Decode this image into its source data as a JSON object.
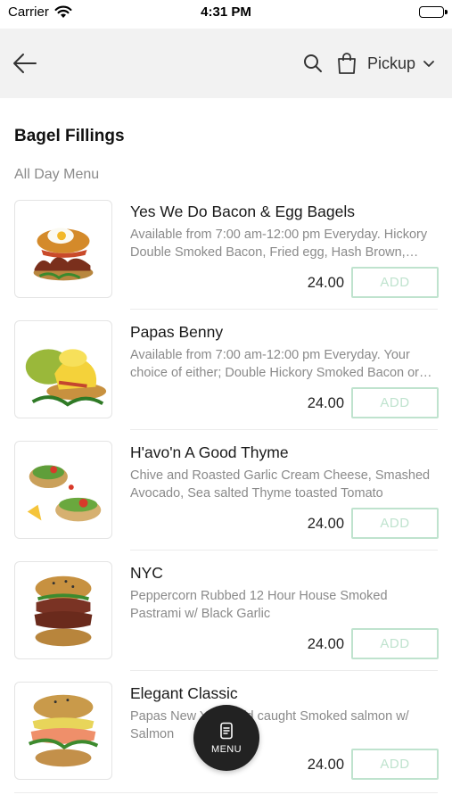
{
  "status_bar": {
    "carrier": "Carrier",
    "time": "4:31 PM"
  },
  "header": {
    "back_icon": "arrow-left-icon",
    "search_icon": "search-icon",
    "bag_icon": "shopping-bag-icon",
    "pickup_label": "Pickup",
    "dropdown_icon": "chevron-down-icon",
    "background": "#f2f2f2"
  },
  "category": {
    "title": "Bagel Fillings",
    "subtitle": "All Day Menu"
  },
  "items": [
    {
      "name": "Yes We Do Bacon & Egg Bagels",
      "description": "Available from 7:00 am-12:00 pm  Everyday. Hickory Double Smoked Bacon, Fried egg, Hash Brown, Tomato Relish",
      "price": "24.00",
      "add_label": "ADD"
    },
    {
      "name": "Papas Benny",
      "description": "Available from  7:00 am-12:00 pm Everyday. Your choice of either; Double Hickory Smoked Bacon or Smoked Salmon",
      "price": "24.00",
      "add_label": "ADD"
    },
    {
      "name": "H'avo'n A Good Thyme",
      "description": "Chive and Roasted Garlic Cream Cheese, Smashed Avocado, Sea salted Thyme toasted Tomato",
      "price": "24.00",
      "add_label": "ADD"
    },
    {
      "name": "NYC",
      "description": "Peppercorn Rubbed 12 Hour House Smoked Pastrami w/ Black Garlic",
      "price": "24.00",
      "add_label": "ADD"
    },
    {
      "name": "Elegant Classic",
      "description": "Papas New York Wild caught Smoked salmon w/ Salmon",
      "price": "24.00",
      "add_label": "ADD"
    }
  ],
  "fab": {
    "label": "MENU",
    "icon": "menu-book-icon"
  },
  "colors": {
    "accent": "#bfe3ce",
    "fab": "#222222",
    "muted_text": "#8a8a8a"
  }
}
